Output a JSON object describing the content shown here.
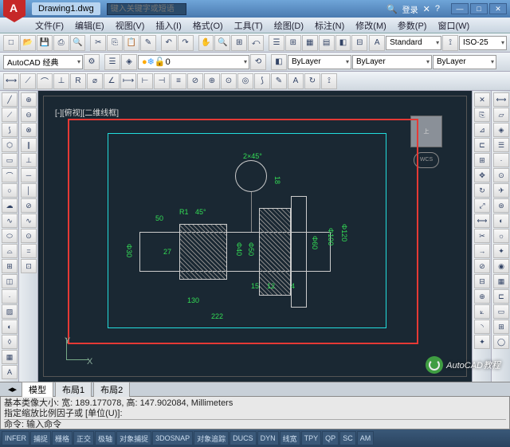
{
  "title_tab": "Drawing1.dwg",
  "search_placeholder": "键入关键字或短语",
  "login_text": "登录",
  "menus": [
    "文件(F)",
    "编辑(E)",
    "视图(V)",
    "插入(I)",
    "格式(O)",
    "工具(T)",
    "绘图(D)",
    "标注(N)",
    "修改(M)",
    "参数(P)",
    "窗口(W)"
  ],
  "workspace_combo": "AutoCAD 经典",
  "layer_combo": "0",
  "bylayer": "ByLayer",
  "style_combo": "Standard",
  "dimstyle_combo": "ISO-25",
  "viewport_label": "[-][俯视][二维线框]",
  "nav_cube": "上",
  "nav_wheel": "WCS",
  "ucs": {
    "x": "X",
    "y": "Y"
  },
  "dims": {
    "d222": "222",
    "d130": "130",
    "d50": "50",
    "d27": "27",
    "d15": "15",
    "d12": "12",
    "d4": "4",
    "r1": "R1",
    "a45": "45°",
    "p30": "Φ30",
    "p40": "Φ40",
    "p50": "Φ50",
    "p60": "Φ60",
    "p100": "Φ100",
    "p120": "Φ120",
    "c2": "2×45°",
    "h18": "18"
  },
  "tabs": {
    "model": "模型",
    "layout1": "布局1",
    "layout2": "布局2"
  },
  "cmd": {
    "line1": "基本类像大小: 宽: 189.177078, 高: 147.902084, Millimeters",
    "line2": "指定缩放比例因子或 [单位(U)]:",
    "prompt": "命令: 输入命令"
  },
  "status": [
    "INFER",
    "捕捉",
    "栅格",
    "正交",
    "极轴",
    "对象捕捉",
    "3DOSNAP",
    "对象追踪",
    "DUCS",
    "DYN",
    "线宽",
    "TPY",
    "QP",
    "SC",
    "AM"
  ],
  "watermark": "AutoCAD教程"
}
